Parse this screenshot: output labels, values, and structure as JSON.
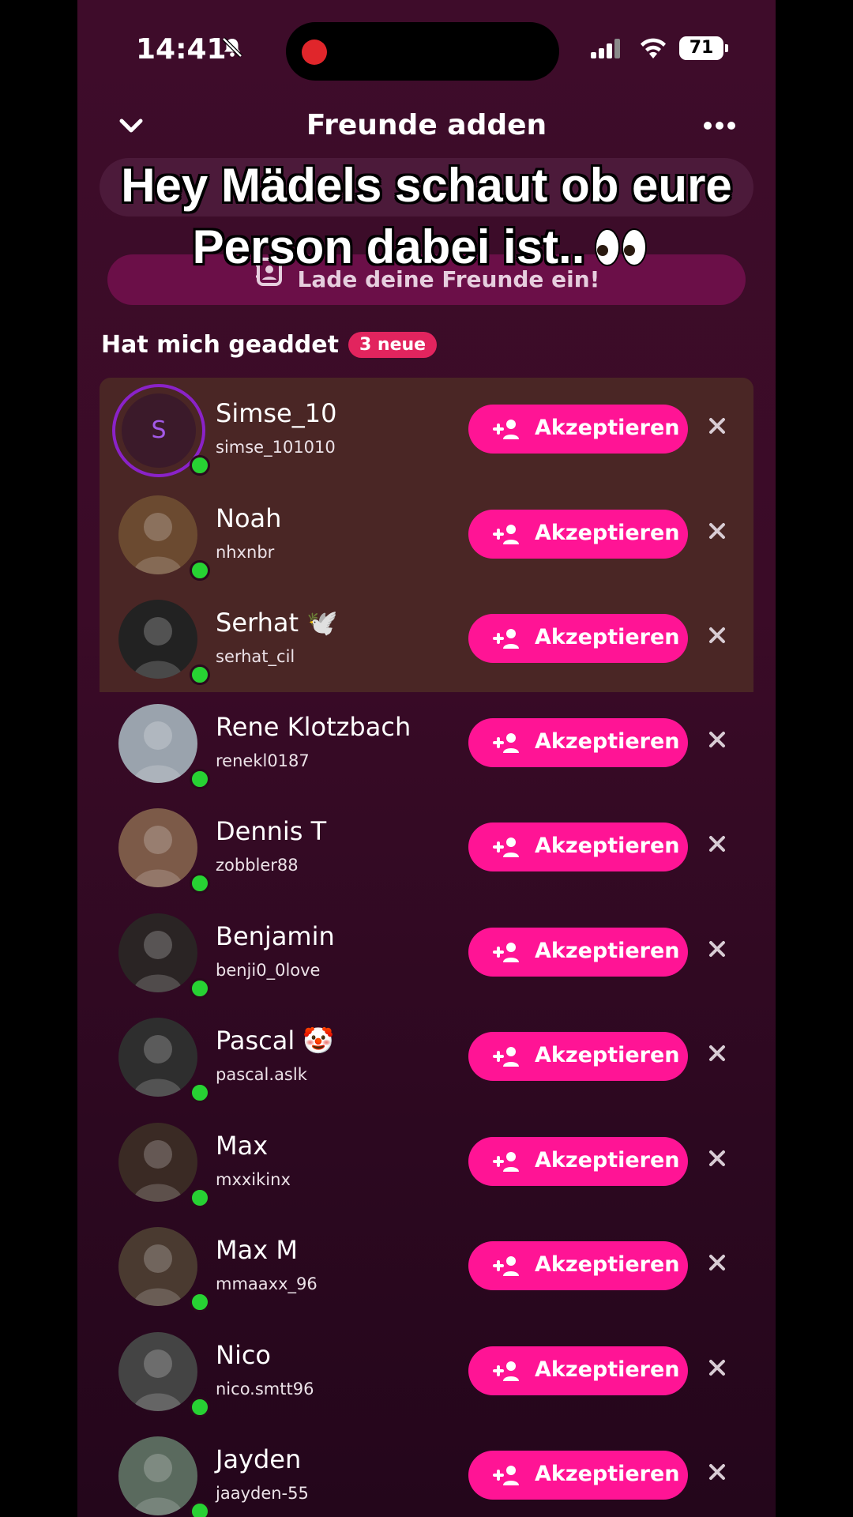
{
  "status": {
    "time": "14:41",
    "battery": "71"
  },
  "header": {
    "title": "Freunde adden"
  },
  "invite": {
    "label": "Lade deine Freunde ein!"
  },
  "overlay": {
    "line1": "Hey Mädels schaut ob eure",
    "line2": "Person dabei ist.."
  },
  "section": {
    "title": "Hat mich geaddet",
    "badge": "3 neue"
  },
  "accept_label": "Akzeptieren",
  "requests": [
    {
      "name": "Simse_10",
      "username": "simse_101010",
      "initial": "S",
      "emoji": ""
    },
    {
      "name": "Noah",
      "username": "nhxnbr",
      "emoji": ""
    },
    {
      "name": "Serhat",
      "username": "serhat_cil",
      "emoji": "🕊️"
    },
    {
      "name": "Rene Klotzbach",
      "username": "renekl0187",
      "emoji": ""
    },
    {
      "name": "Dennis T",
      "username": "zobbler88",
      "emoji": ""
    },
    {
      "name": "Benjamin",
      "username": "benji0_0love",
      "emoji": ""
    },
    {
      "name": "Pascal",
      "username": "pascal.aslk",
      "emoji": "🤡"
    },
    {
      "name": "Max",
      "username": "mxxikinx",
      "emoji": ""
    },
    {
      "name": "Max M",
      "username": "mmaaxx_96",
      "emoji": ""
    },
    {
      "name": "Nico",
      "username": "nico.smtt96",
      "emoji": ""
    },
    {
      "name": "Jayden",
      "username": "jaayden-55",
      "emoji": ""
    }
  ]
}
